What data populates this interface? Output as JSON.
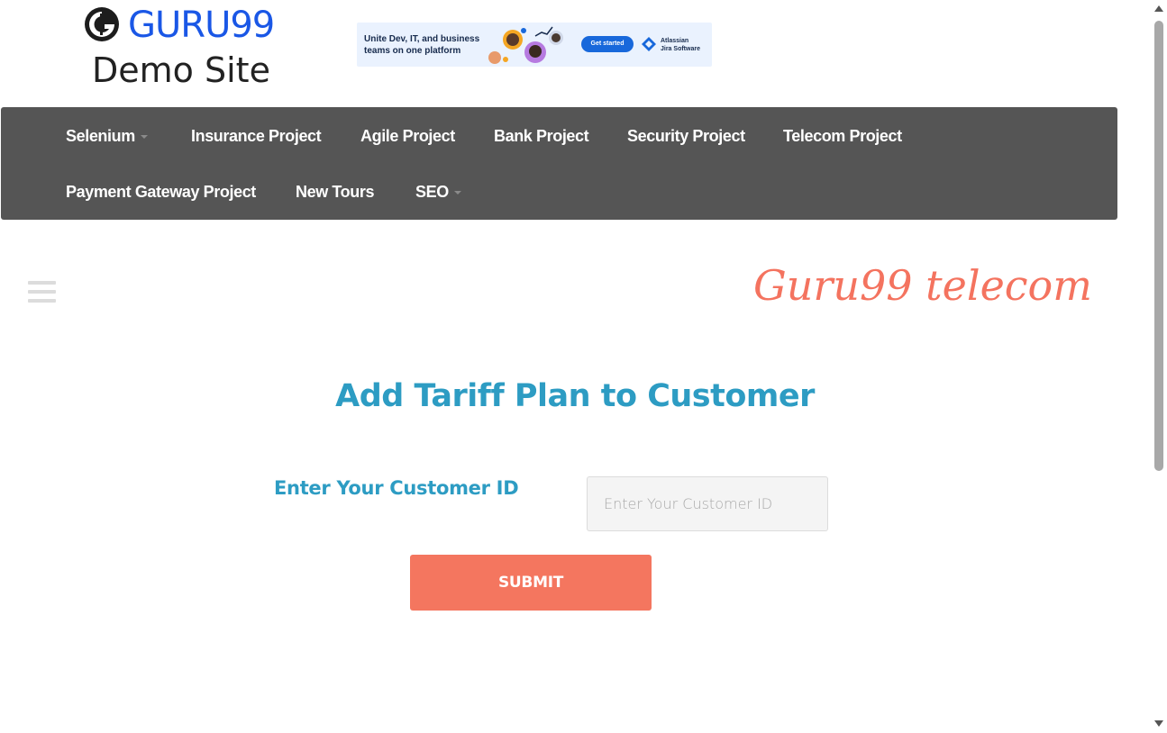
{
  "header": {
    "logo_text": "GURU99",
    "logo_subtitle": "Demo Site"
  },
  "ad": {
    "headline": "Unite Dev, IT, and business teams on one platform",
    "cta": "Get started",
    "brand_line1": "Atlassian",
    "brand_line2": "Jira Software"
  },
  "nav": {
    "items": [
      {
        "label": "Selenium",
        "dropdown": true
      },
      {
        "label": "Insurance Project"
      },
      {
        "label": "Agile Project"
      },
      {
        "label": "Bank Project"
      },
      {
        "label": "Security Project"
      },
      {
        "label": "Telecom Project"
      },
      {
        "label": "Payment Gateway Project"
      },
      {
        "label": "New Tours"
      },
      {
        "label": "SEO",
        "dropdown": true
      }
    ]
  },
  "brand": {
    "text": "Guru99 telecom",
    "color": "#f4735f"
  },
  "form": {
    "title": "Add Tariff Plan to Customer",
    "field_label": "Enter Your Customer ID",
    "field_placeholder": "Enter Your Customer ID",
    "field_value": "",
    "submit_label": "SUBMIT"
  },
  "colors": {
    "navbar": "#555555",
    "accent_blue": "#2d9cc3",
    "submit": "#f4765f",
    "logo_blue": "#1a57e6"
  },
  "icons": [
    "guru99-logo-icon",
    "hamburger-menu-icon",
    "caret-down-icon",
    "jira-icon"
  ]
}
